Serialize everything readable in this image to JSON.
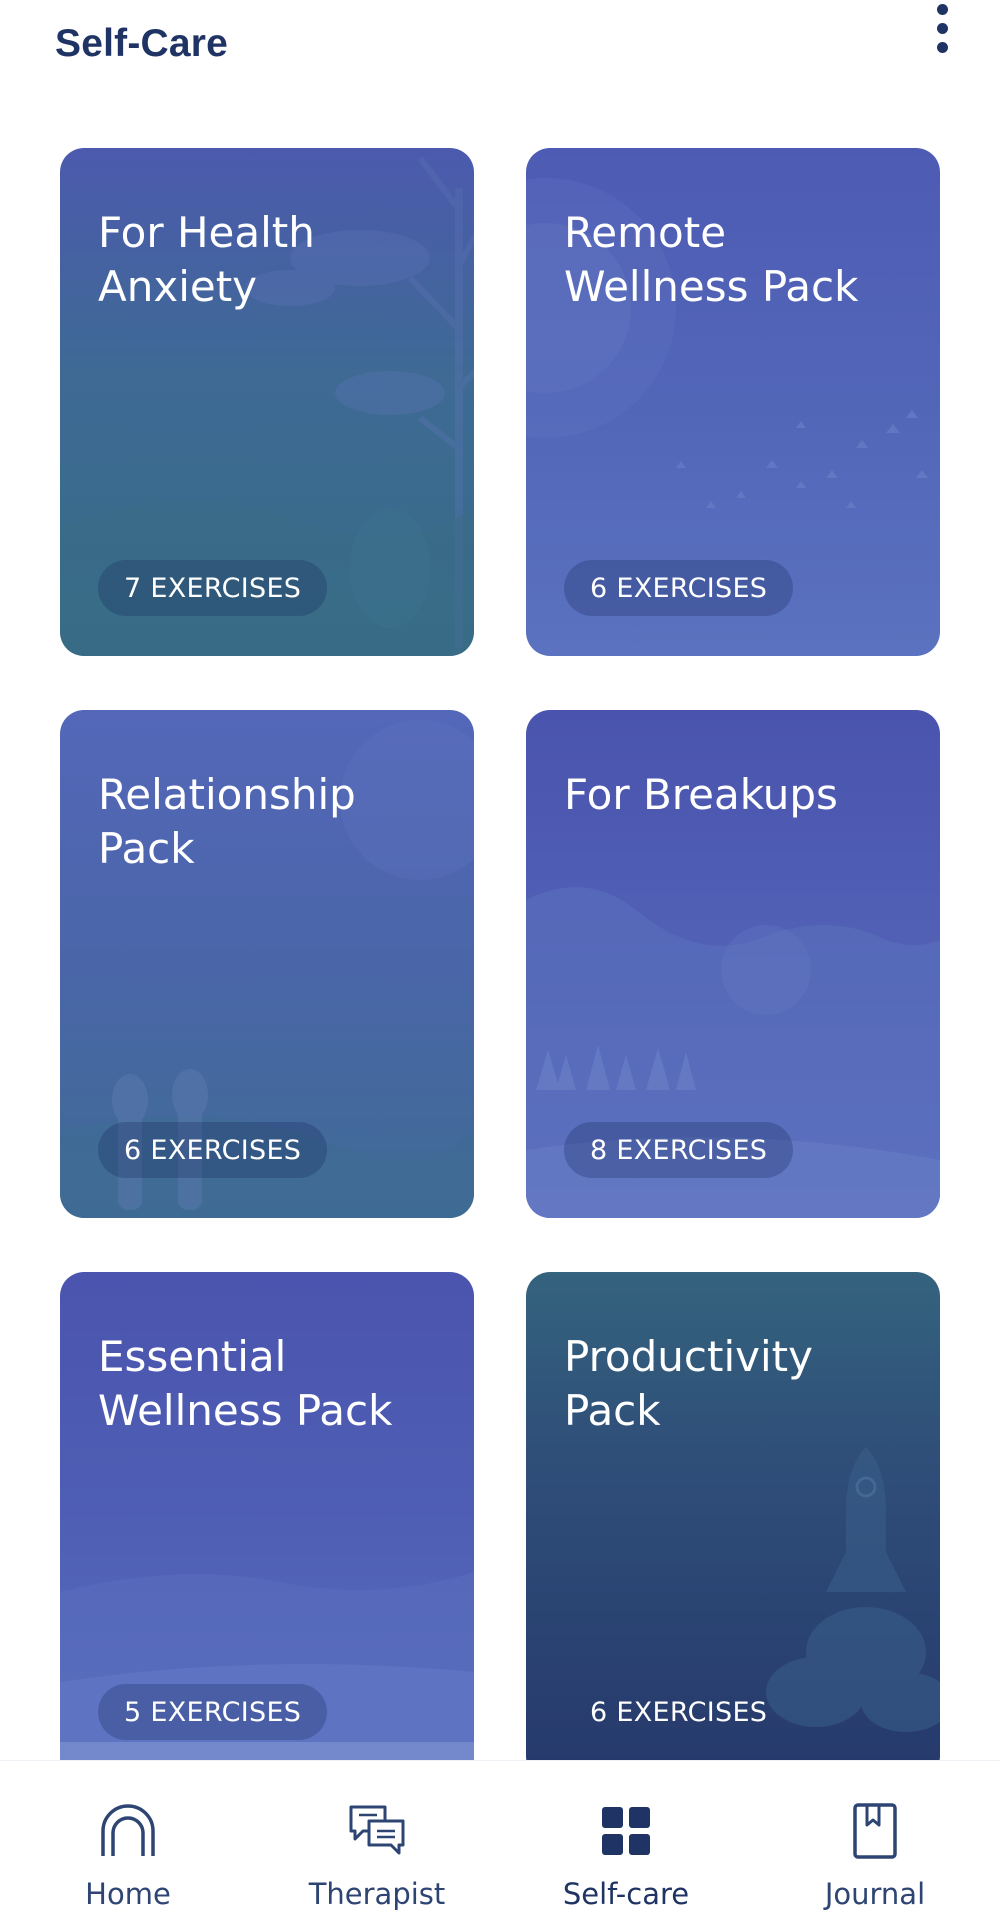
{
  "header": {
    "title": "Self-Care",
    "menu_icon": "more-vertical-icon"
  },
  "packs": [
    {
      "title": "For Health\nAnxiety",
      "exercises": "7 EXERCISES"
    },
    {
      "title": "Remote\nWellness Pack",
      "exercises": "6 EXERCISES"
    },
    {
      "title": "Relationship\nPack",
      "exercises": "6 EXERCISES"
    },
    {
      "title": "For Breakups",
      "exercises": "8 EXERCISES"
    },
    {
      "title": "Essential\nWellness Pack",
      "exercises": "5 EXERCISES"
    },
    {
      "title": "Productivity\nPack",
      "exercises": "6 EXERCISES"
    }
  ],
  "nav": {
    "active": "Self-care",
    "items": [
      {
        "label": "Home",
        "icon": "home-arch-icon"
      },
      {
        "label": "Therapist",
        "icon": "chat-bubbles-icon"
      },
      {
        "label": "Self-care",
        "icon": "grid-icon"
      },
      {
        "label": "Journal",
        "icon": "journal-bookmark-icon"
      }
    ]
  },
  "colors": {
    "primary_text": "#1f3464",
    "nav_text": "#2e4574",
    "card_text": "#ffffff"
  }
}
